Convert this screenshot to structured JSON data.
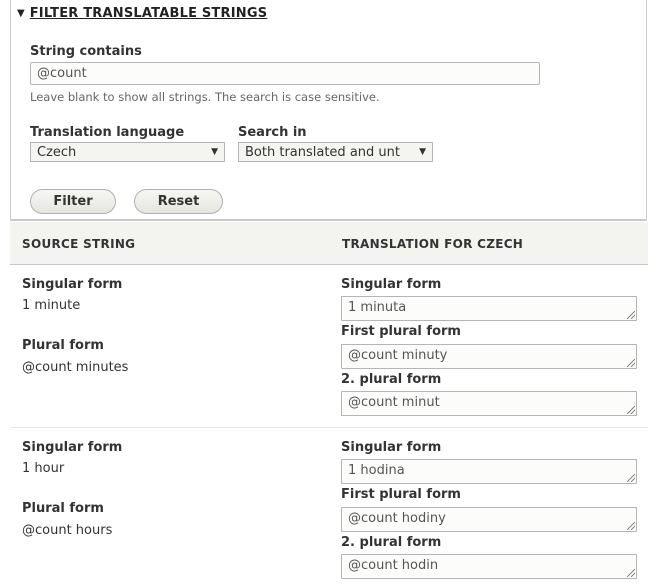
{
  "filter": {
    "legend": "FILTER TRANSLATABLE STRINGS",
    "legend_icon": "triangle-down-icon",
    "string_contains": {
      "label": "String contains",
      "value": "@count",
      "description": "Leave blank to show all strings. The search is case sensitive."
    },
    "translation_language": {
      "label": "Translation language",
      "selected": "Czech",
      "arrow_icon": "▼"
    },
    "search_in": {
      "label": "Search in",
      "selected": "Both translated and unt",
      "arrow_icon": "▼"
    },
    "buttons": {
      "filter": "Filter",
      "reset": "Reset"
    }
  },
  "table": {
    "headers": {
      "source": "SOURCE STRING",
      "translation": "TRANSLATION FOR CZECH"
    },
    "rows": [
      {
        "source": {
          "singular_label": "Singular form",
          "singular": "1 minute",
          "plural_label": "Plural form",
          "plural": "@count minutes"
        },
        "translation": [
          {
            "label": "Singular form",
            "value": "1 minuta"
          },
          {
            "label": "First plural form",
            "value": "@count minuty"
          },
          {
            "label": "2. plural form",
            "value": "@count minut"
          }
        ]
      },
      {
        "source": {
          "singular_label": "Singular form",
          "singular": "1 hour",
          "plural_label": "Plural form",
          "plural": "@count hours"
        },
        "translation": [
          {
            "label": "Singular form",
            "value": "1 hodina"
          },
          {
            "label": "First plural form",
            "value": "@count hodiny"
          },
          {
            "label": "2. plural form",
            "value": "@count hodin"
          }
        ]
      }
    ]
  }
}
